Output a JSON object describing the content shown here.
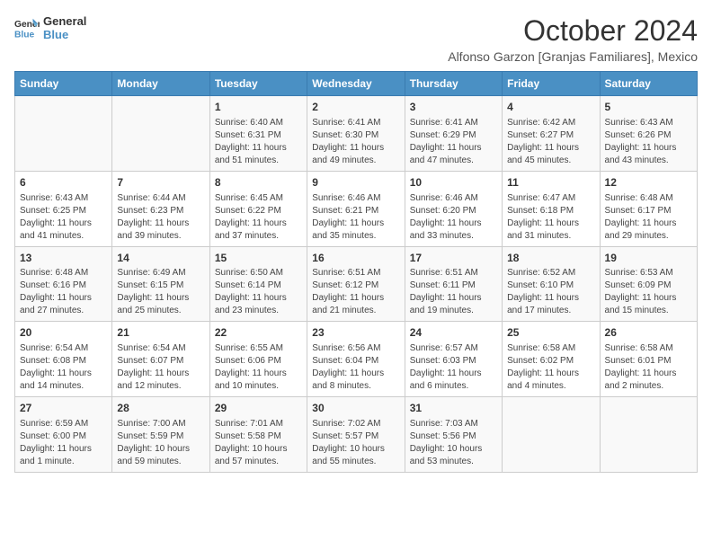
{
  "logo": {
    "line1": "General",
    "line2": "Blue"
  },
  "title": "October 2024",
  "subtitle": "Alfonso Garzon [Granjas Familiares], Mexico",
  "days_of_week": [
    "Sunday",
    "Monday",
    "Tuesday",
    "Wednesday",
    "Thursday",
    "Friday",
    "Saturday"
  ],
  "weeks": [
    [
      {
        "day": "",
        "sunrise": "",
        "sunset": "",
        "daylight": ""
      },
      {
        "day": "",
        "sunrise": "",
        "sunset": "",
        "daylight": ""
      },
      {
        "day": "1",
        "sunrise": "Sunrise: 6:40 AM",
        "sunset": "Sunset: 6:31 PM",
        "daylight": "Daylight: 11 hours and 51 minutes."
      },
      {
        "day": "2",
        "sunrise": "Sunrise: 6:41 AM",
        "sunset": "Sunset: 6:30 PM",
        "daylight": "Daylight: 11 hours and 49 minutes."
      },
      {
        "day": "3",
        "sunrise": "Sunrise: 6:41 AM",
        "sunset": "Sunset: 6:29 PM",
        "daylight": "Daylight: 11 hours and 47 minutes."
      },
      {
        "day": "4",
        "sunrise": "Sunrise: 6:42 AM",
        "sunset": "Sunset: 6:27 PM",
        "daylight": "Daylight: 11 hours and 45 minutes."
      },
      {
        "day": "5",
        "sunrise": "Sunrise: 6:43 AM",
        "sunset": "Sunset: 6:26 PM",
        "daylight": "Daylight: 11 hours and 43 minutes."
      }
    ],
    [
      {
        "day": "6",
        "sunrise": "Sunrise: 6:43 AM",
        "sunset": "Sunset: 6:25 PM",
        "daylight": "Daylight: 11 hours and 41 minutes."
      },
      {
        "day": "7",
        "sunrise": "Sunrise: 6:44 AM",
        "sunset": "Sunset: 6:23 PM",
        "daylight": "Daylight: 11 hours and 39 minutes."
      },
      {
        "day": "8",
        "sunrise": "Sunrise: 6:45 AM",
        "sunset": "Sunset: 6:22 PM",
        "daylight": "Daylight: 11 hours and 37 minutes."
      },
      {
        "day": "9",
        "sunrise": "Sunrise: 6:46 AM",
        "sunset": "Sunset: 6:21 PM",
        "daylight": "Daylight: 11 hours and 35 minutes."
      },
      {
        "day": "10",
        "sunrise": "Sunrise: 6:46 AM",
        "sunset": "Sunset: 6:20 PM",
        "daylight": "Daylight: 11 hours and 33 minutes."
      },
      {
        "day": "11",
        "sunrise": "Sunrise: 6:47 AM",
        "sunset": "Sunset: 6:18 PM",
        "daylight": "Daylight: 11 hours and 31 minutes."
      },
      {
        "day": "12",
        "sunrise": "Sunrise: 6:48 AM",
        "sunset": "Sunset: 6:17 PM",
        "daylight": "Daylight: 11 hours and 29 minutes."
      }
    ],
    [
      {
        "day": "13",
        "sunrise": "Sunrise: 6:48 AM",
        "sunset": "Sunset: 6:16 PM",
        "daylight": "Daylight: 11 hours and 27 minutes."
      },
      {
        "day": "14",
        "sunrise": "Sunrise: 6:49 AM",
        "sunset": "Sunset: 6:15 PM",
        "daylight": "Daylight: 11 hours and 25 minutes."
      },
      {
        "day": "15",
        "sunrise": "Sunrise: 6:50 AM",
        "sunset": "Sunset: 6:14 PM",
        "daylight": "Daylight: 11 hours and 23 minutes."
      },
      {
        "day": "16",
        "sunrise": "Sunrise: 6:51 AM",
        "sunset": "Sunset: 6:12 PM",
        "daylight": "Daylight: 11 hours and 21 minutes."
      },
      {
        "day": "17",
        "sunrise": "Sunrise: 6:51 AM",
        "sunset": "Sunset: 6:11 PM",
        "daylight": "Daylight: 11 hours and 19 minutes."
      },
      {
        "day": "18",
        "sunrise": "Sunrise: 6:52 AM",
        "sunset": "Sunset: 6:10 PM",
        "daylight": "Daylight: 11 hours and 17 minutes."
      },
      {
        "day": "19",
        "sunrise": "Sunrise: 6:53 AM",
        "sunset": "Sunset: 6:09 PM",
        "daylight": "Daylight: 11 hours and 15 minutes."
      }
    ],
    [
      {
        "day": "20",
        "sunrise": "Sunrise: 6:54 AM",
        "sunset": "Sunset: 6:08 PM",
        "daylight": "Daylight: 11 hours and 14 minutes."
      },
      {
        "day": "21",
        "sunrise": "Sunrise: 6:54 AM",
        "sunset": "Sunset: 6:07 PM",
        "daylight": "Daylight: 11 hours and 12 minutes."
      },
      {
        "day": "22",
        "sunrise": "Sunrise: 6:55 AM",
        "sunset": "Sunset: 6:06 PM",
        "daylight": "Daylight: 11 hours and 10 minutes."
      },
      {
        "day": "23",
        "sunrise": "Sunrise: 6:56 AM",
        "sunset": "Sunset: 6:04 PM",
        "daylight": "Daylight: 11 hours and 8 minutes."
      },
      {
        "day": "24",
        "sunrise": "Sunrise: 6:57 AM",
        "sunset": "Sunset: 6:03 PM",
        "daylight": "Daylight: 11 hours and 6 minutes."
      },
      {
        "day": "25",
        "sunrise": "Sunrise: 6:58 AM",
        "sunset": "Sunset: 6:02 PM",
        "daylight": "Daylight: 11 hours and 4 minutes."
      },
      {
        "day": "26",
        "sunrise": "Sunrise: 6:58 AM",
        "sunset": "Sunset: 6:01 PM",
        "daylight": "Daylight: 11 hours and 2 minutes."
      }
    ],
    [
      {
        "day": "27",
        "sunrise": "Sunrise: 6:59 AM",
        "sunset": "Sunset: 6:00 PM",
        "daylight": "Daylight: 11 hours and 1 minute."
      },
      {
        "day": "28",
        "sunrise": "Sunrise: 7:00 AM",
        "sunset": "Sunset: 5:59 PM",
        "daylight": "Daylight: 10 hours and 59 minutes."
      },
      {
        "day": "29",
        "sunrise": "Sunrise: 7:01 AM",
        "sunset": "Sunset: 5:58 PM",
        "daylight": "Daylight: 10 hours and 57 minutes."
      },
      {
        "day": "30",
        "sunrise": "Sunrise: 7:02 AM",
        "sunset": "Sunset: 5:57 PM",
        "daylight": "Daylight: 10 hours and 55 minutes."
      },
      {
        "day": "31",
        "sunrise": "Sunrise: 7:03 AM",
        "sunset": "Sunset: 5:56 PM",
        "daylight": "Daylight: 10 hours and 53 minutes."
      },
      {
        "day": "",
        "sunrise": "",
        "sunset": "",
        "daylight": ""
      },
      {
        "day": "",
        "sunrise": "",
        "sunset": "",
        "daylight": ""
      }
    ]
  ]
}
